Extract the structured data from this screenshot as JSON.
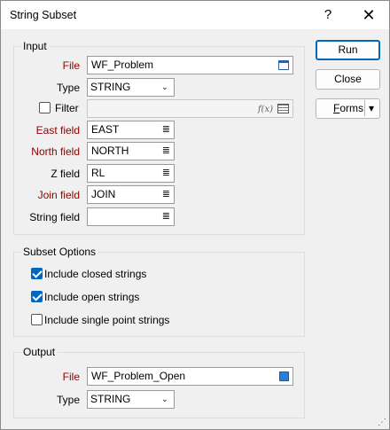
{
  "window": {
    "title": "String Subset",
    "help_glyph": "?",
    "close_glyph": "✕"
  },
  "buttons": {
    "run": "Run",
    "close": "Close",
    "forms_prefix": "F",
    "forms_rest": "orms",
    "forms_arrow": "▾"
  },
  "input": {
    "group_title": "Input",
    "file_label": "File",
    "file_value": "WF_Problem",
    "type_label": "Type",
    "type_value": "STRING",
    "filter_label": "Filter",
    "filter_checked": false,
    "filter_value": "",
    "fx_glyph": "f(x)",
    "east_label": "East field",
    "east_value": "EAST",
    "north_label": "North field",
    "north_value": "NORTH",
    "z_label": "Z field",
    "z_value": "RL",
    "join_label": "Join field",
    "join_value": "JOIN",
    "string_label": "String field",
    "string_value": "",
    "list_glyph": "≣"
  },
  "subset": {
    "group_title": "Subset Options",
    "options": [
      {
        "label": "Include closed strings",
        "checked": true
      },
      {
        "label": "Include open strings",
        "checked": true
      },
      {
        "label": "Include single point strings",
        "checked": false
      }
    ]
  },
  "output": {
    "group_title": "Output",
    "file_label": "File",
    "file_value": "WF_Problem_Open",
    "type_label": "Type",
    "type_value": "STRING"
  },
  "chevron_glyph": "⌄",
  "resize_glyph": "⋰"
}
